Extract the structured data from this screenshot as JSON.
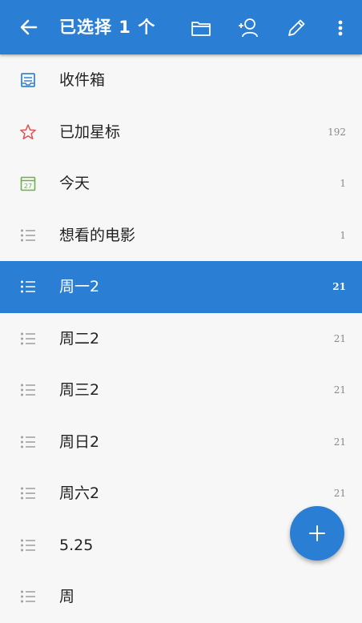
{
  "colors": {
    "accent": "#2a7fd4",
    "star": "#e05252",
    "calendar": "#69b347",
    "inbox": "#3a86d0",
    "list": "#9e9e9e"
  },
  "appbar": {
    "title": "已选择 1 个",
    "icons": [
      "back-arrow-icon",
      "folder-icon",
      "add-person-icon",
      "pencil-icon",
      "more-vert-icon"
    ]
  },
  "lists": [
    {
      "label": "收件箱",
      "count": "",
      "icon": "inbox-icon"
    },
    {
      "label": "已加星标",
      "count": "192",
      "icon": "star-icon"
    },
    {
      "label": "今天",
      "count": "1",
      "icon": "calendar-icon"
    },
    {
      "label": "想看的电影",
      "count": "1",
      "icon": "list-icon"
    },
    {
      "label": "周一2",
      "count": "21",
      "icon": "list-icon",
      "selected": true
    },
    {
      "label": "周二2",
      "count": "21",
      "icon": "list-icon"
    },
    {
      "label": "周三2",
      "count": "21",
      "icon": "list-icon"
    },
    {
      "label": "周日2",
      "count": "21",
      "icon": "list-icon"
    },
    {
      "label": "周六2",
      "count": "21",
      "icon": "list-icon"
    },
    {
      "label": "5.25",
      "count": "",
      "icon": "list-icon"
    },
    {
      "label": "周",
      "count": "",
      "icon": "list-icon"
    }
  ],
  "calendar_icon_day": "27",
  "fab": {
    "icon": "plus-icon"
  }
}
